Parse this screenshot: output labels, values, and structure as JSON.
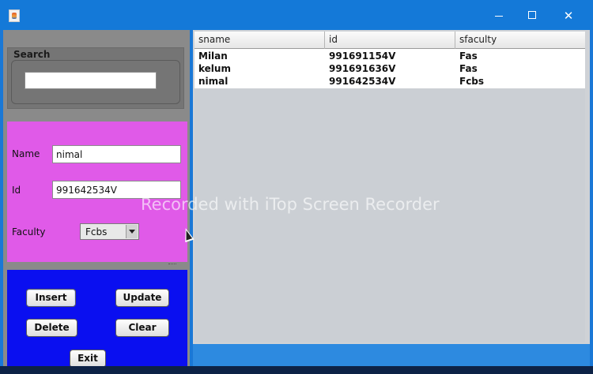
{
  "window": {
    "title": "",
    "controls": {
      "minimize": "minimize",
      "maximize": "maximize",
      "close": "✕"
    }
  },
  "search": {
    "title": "Search",
    "value": "",
    "placeholder": ""
  },
  "form": {
    "name_label": "Name",
    "name_value": "nimal",
    "id_label": "Id",
    "id_value": "991642534V",
    "faculty_label": "Faculty",
    "faculty_value": "Fcbs"
  },
  "buttons": {
    "insert": "Insert",
    "update": "Update",
    "delete": "Delete",
    "clear": "Clear",
    "exit": "Exit"
  },
  "table": {
    "columns": [
      "sname",
      "id",
      "sfaculty"
    ],
    "rows": [
      [
        "Milan",
        "991691154V",
        "Fas"
      ],
      [
        "kelum",
        "991691636V",
        "Fas"
      ],
      [
        "nimal",
        "991642534V",
        "Fcbs"
      ]
    ]
  },
  "overlay": {
    "watermark": "Recorded with iTop Screen Recorder"
  },
  "colors": {
    "titlebar": "#1479d8",
    "form_panel": "#e05ae8",
    "buttons_panel": "#0a0ff0",
    "left_panel": "#8a8a8a"
  }
}
